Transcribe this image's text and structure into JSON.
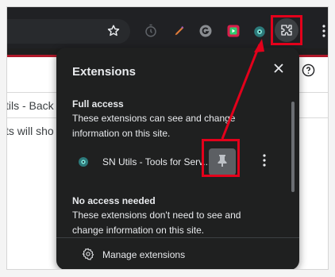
{
  "browser": {
    "toolbar_icons": [
      "bookmark-star-icon",
      "timer-extension-icon",
      "pen-extension-icon",
      "grammarly-icon",
      "video-extension-icon",
      "sn-utils-icon",
      "extensions-puzzle-icon",
      "menu-dots-icon"
    ],
    "help_icon": "help-icon"
  },
  "page": {
    "line1": "tils - Back",
    "line2": "ts will sho"
  },
  "extensions_panel": {
    "title": "Extensions",
    "close_icon": "close-icon",
    "full_access": {
      "heading": "Full access",
      "description": "These extensions can see and change information on this site."
    },
    "extension": {
      "name": "SN Utils - Tools for Serv...",
      "icon": "sn-utils-icon",
      "pin_icon": "pin-icon",
      "more_icon": "more-vert-icon"
    },
    "no_access": {
      "heading": "No access needed",
      "description": "These extensions don't need to see and change information on this site."
    },
    "manage_label": "Manage extensions",
    "manage_icon": "gear-icon"
  },
  "colors": {
    "toolbar_bg": "#202124",
    "panel_bg": "#1f2020",
    "highlight": "#e3001b",
    "accent_red": "#b0182a"
  }
}
